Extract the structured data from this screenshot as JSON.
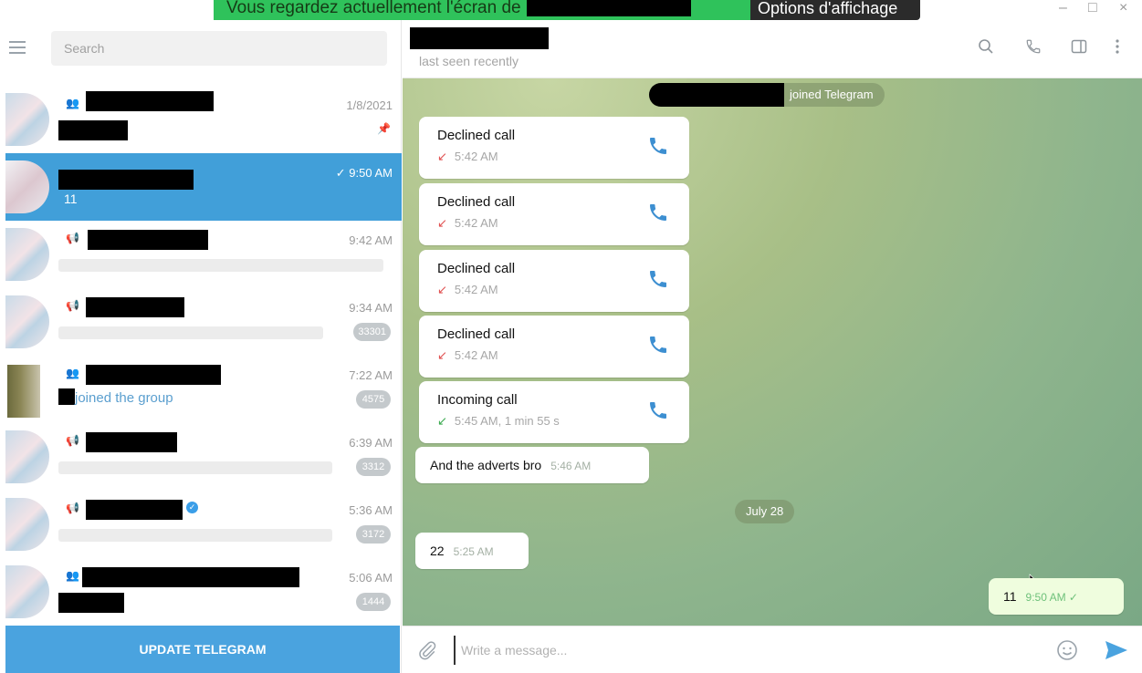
{
  "banner": {
    "text_before": "Vous regardez actuellement l'écran de",
    "options": "Options d'affichage",
    "minimize": "–",
    "maximize": "□",
    "close": "×"
  },
  "sidebar": {
    "search_placeholder": "Search",
    "chats": [
      {
        "type": "group",
        "time": "1/8/2021",
        "pinned": true
      },
      {
        "type": "private",
        "time": "✓ 9:50 AM",
        "preview": "11",
        "active": true
      },
      {
        "type": "channel",
        "time": "9:42 AM"
      },
      {
        "type": "channel",
        "time": "9:34 AM",
        "badge": "33301"
      },
      {
        "type": "group",
        "time": "7:22 AM",
        "preview": "joined the group",
        "badge": "4575"
      },
      {
        "type": "channel",
        "time": "6:39 AM",
        "badge": "3312"
      },
      {
        "type": "channel",
        "time": "5:36 AM",
        "badge": "3172",
        "verified": true
      },
      {
        "type": "group",
        "time": "5:06 AM",
        "badge": "1444"
      }
    ],
    "update_button": "UPDATE TELEGRAM"
  },
  "header": {
    "status": "last seen recently"
  },
  "messages": {
    "joined_service": "joined Telegram",
    "calls": [
      {
        "title": "Declined call",
        "time": "5:42 AM",
        "direction": "out"
      },
      {
        "title": "Declined call",
        "time": "5:42 AM",
        "direction": "out"
      },
      {
        "title": "Declined call",
        "time": "5:42 AM",
        "direction": "out"
      },
      {
        "title": "Declined call",
        "time": "5:42 AM",
        "direction": "out"
      },
      {
        "title": "Incoming call",
        "time": "5:45 AM, 1 min 55 s",
        "direction": "in"
      }
    ],
    "text1": {
      "text": "And the adverts bro",
      "time": "5:46 AM"
    },
    "date_sep": "July 28",
    "text2": {
      "text": "22",
      "time": "5:25 AM"
    },
    "text3": {
      "text": "11",
      "time": "9:50 AM ✓"
    }
  },
  "composer": {
    "placeholder": "Write a message..."
  },
  "colors": {
    "accent": "#419fd9",
    "update_button": "#4aa3df",
    "declined": "#e05050",
    "incoming": "#3aaa4f"
  },
  "icons": {
    "group": "group-icon",
    "channel": "megaphone-icon",
    "pin": "pin-icon",
    "phone": "phone-icon",
    "search": "search-icon",
    "call": "phone-icon",
    "sidebar": "sidebar-toggle-icon",
    "more": "more-vertical-icon",
    "attach": "paperclip-icon",
    "emoji": "smile-icon",
    "send": "send-icon"
  }
}
